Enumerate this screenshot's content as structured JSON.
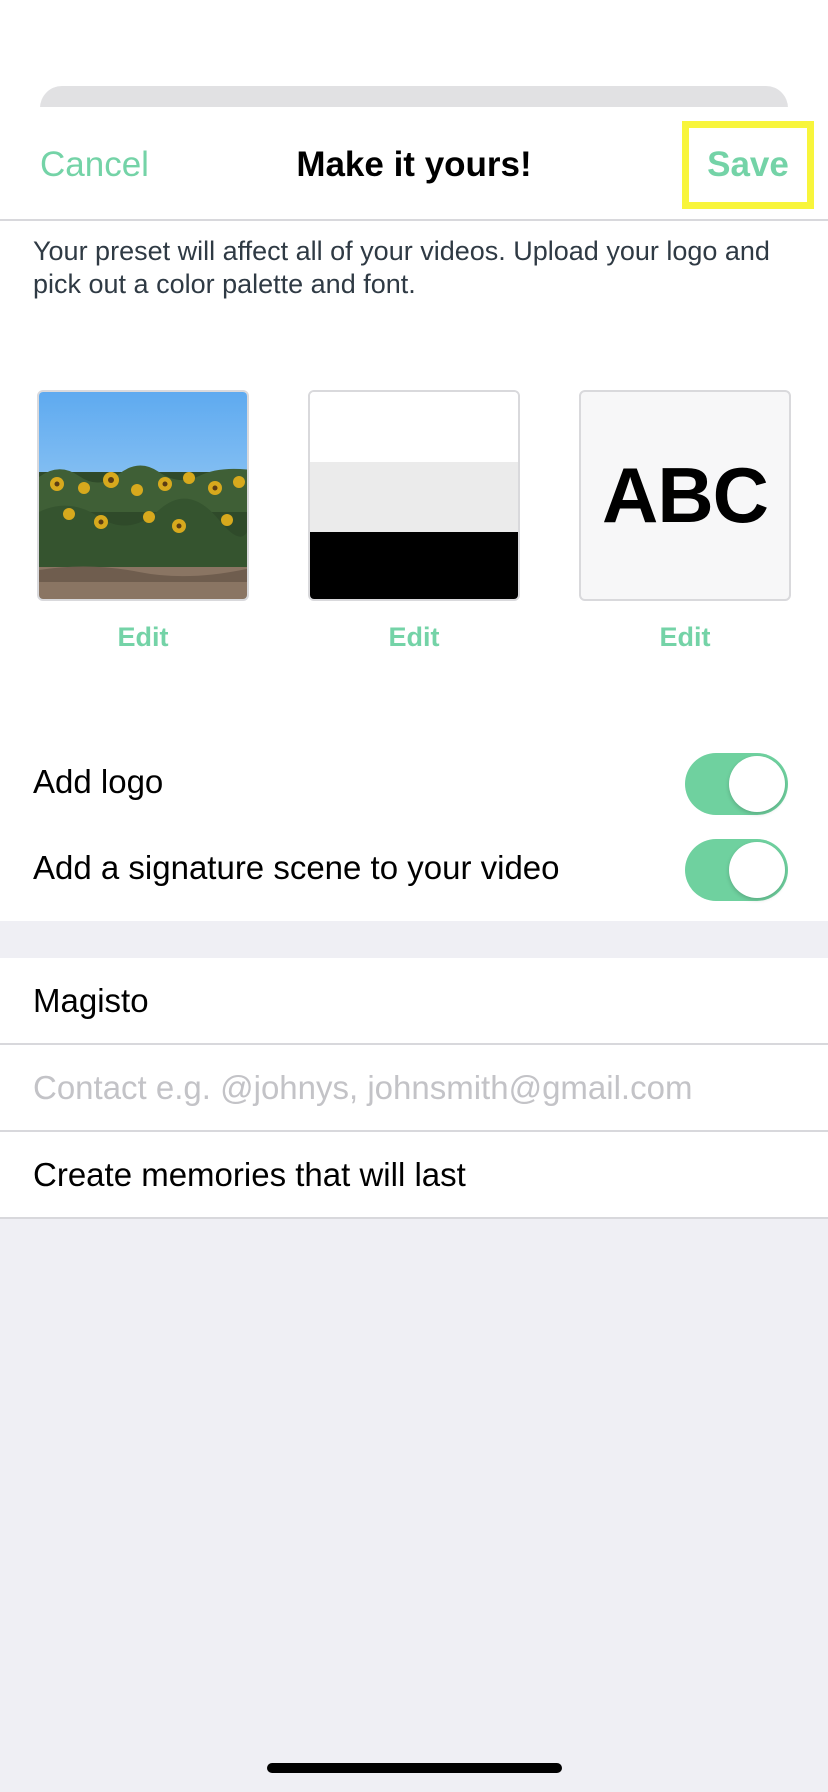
{
  "nav": {
    "cancel_label": "Cancel",
    "title": "Make it yours!",
    "save_label": "Save"
  },
  "intro_text": "Your preset will affect all of your videos. Upload your logo and pick out a color palette and font.",
  "presets": {
    "logo_edit_label": "Edit",
    "colors_edit_label": "Edit",
    "palette": [
      "#ffffff",
      "#ebebeb",
      "#000000"
    ],
    "font_sample": "ABC",
    "font_edit_label": "Edit"
  },
  "toggles": [
    {
      "label": "Add logo",
      "on": true
    },
    {
      "label": "Add a signature scene to your video",
      "on": true
    }
  ],
  "fields": {
    "name_value": "Magisto",
    "contact_placeholder": "Contact e.g. @johnys, johnsmith@gmail.com",
    "tagline_value": "Create memories that will last"
  },
  "colors": {
    "accent": "#74d3a7",
    "switch_on": "#6fd19f",
    "highlight": "#f8f53b"
  }
}
